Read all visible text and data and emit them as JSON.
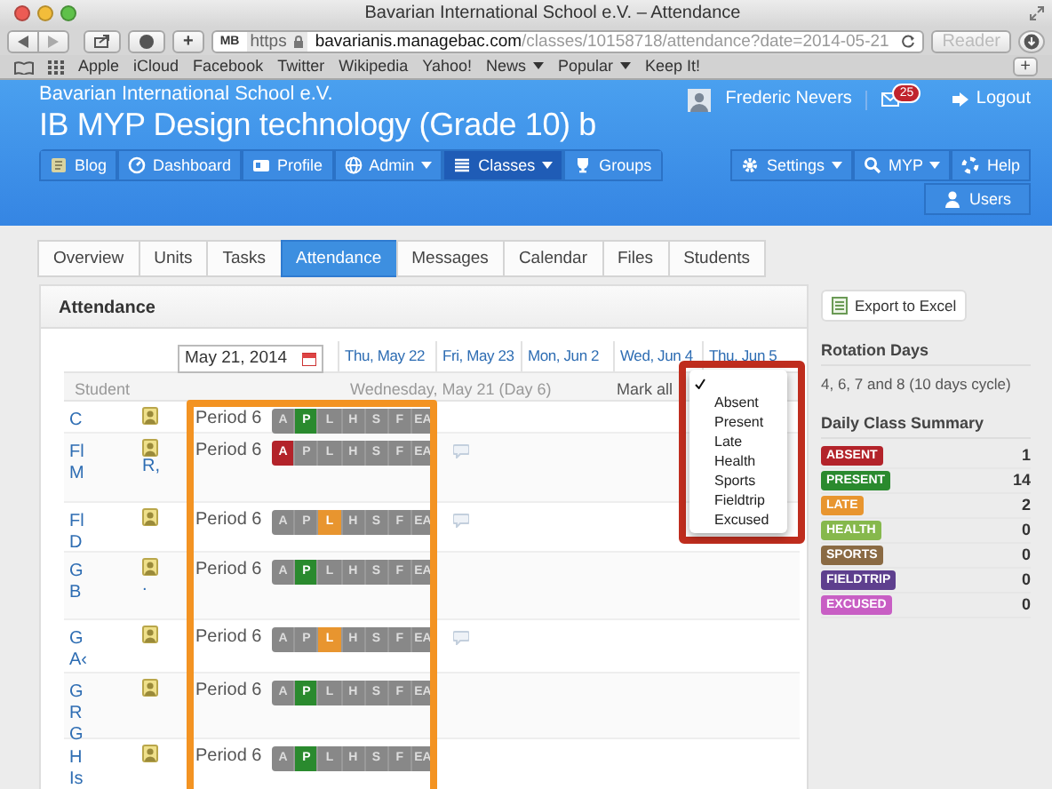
{
  "browser": {
    "title": "Bavarian International School e.V. – Attendance",
    "new_tab": "+",
    "favicon": "MB",
    "scheme": "https",
    "host": "bavarianis.managebac.com",
    "path": "/classes/10158718/attendance?date=2014-05-21",
    "reader": "Reader",
    "reader_disabled": true,
    "bookmarks": [
      {
        "label": "Apple",
        "menu": false
      },
      {
        "label": "iCloud",
        "menu": false
      },
      {
        "label": "Facebook",
        "menu": false
      },
      {
        "label": "Twitter",
        "menu": false
      },
      {
        "label": "Wikipedia",
        "menu": false
      },
      {
        "label": "Yahoo!",
        "menu": false
      },
      {
        "label": "News",
        "menu": true
      },
      {
        "label": "Popular",
        "menu": true
      },
      {
        "label": "Keep It!",
        "menu": false
      }
    ],
    "add_bookmark": "+"
  },
  "header": {
    "school": "Bavarian International School e.V.",
    "class_title": "IB MYP Design technology (Grade 10) b",
    "user": "Frederic Nevers",
    "mail_count": "25",
    "logout": "Logout",
    "nav": [
      {
        "label": "Blog",
        "dropdown": false,
        "selected": false
      },
      {
        "label": "Dashboard",
        "dropdown": false,
        "selected": false
      },
      {
        "label": "Profile",
        "dropdown": false,
        "selected": false
      },
      {
        "label": "Admin",
        "dropdown": true,
        "selected": false
      },
      {
        "label": "Classes",
        "dropdown": true,
        "selected": true
      },
      {
        "label": "Groups",
        "dropdown": false,
        "selected": false
      }
    ],
    "nav_right": [
      {
        "label": "Settings",
        "dropdown": true
      },
      {
        "label": "MYP",
        "dropdown": true
      },
      {
        "label": "Help",
        "dropdown": false
      }
    ],
    "nav_users": "Users"
  },
  "tabs": [
    {
      "label": "Overview",
      "selected": false
    },
    {
      "label": "Units",
      "selected": false
    },
    {
      "label": "Tasks",
      "selected": false
    },
    {
      "label": "Attendance",
      "selected": true
    },
    {
      "label": "Messages",
      "selected": false
    },
    {
      "label": "Calendar",
      "selected": false
    },
    {
      "label": "Files",
      "selected": false
    },
    {
      "label": "Students",
      "selected": false
    }
  ],
  "attendance": {
    "title": "Attendance",
    "date": "May 21, 2014",
    "day_columns": [
      "Thu, May 22",
      "Fri, May 23",
      "Mon, Jun 2",
      "Wed, Jun 4",
      "Thu, Jun 5"
    ],
    "student_header": "Student",
    "day_label": "Wednesday, May 21 (Day 6)",
    "mark_all": "Mark all",
    "rows": [
      {
        "name": [
          "C"
        ],
        "note": [],
        "period": "Period 6",
        "comment": false,
        "marks": [
          {
            "code": "A",
            "selected": false
          },
          {
            "code": "P",
            "selected": true
          },
          {
            "code": "L",
            "selected": false
          },
          {
            "code": "H",
            "selected": false
          },
          {
            "code": "S",
            "selected": false
          },
          {
            "code": "F",
            "selected": false
          },
          {
            "code": "EA",
            "selected": false
          }
        ]
      },
      {
        "name": [
          "Fl",
          "M"
        ],
        "note": [
          "R,"
        ],
        "period": "Period 6",
        "comment": true,
        "marks": [
          {
            "code": "A",
            "selected": true
          },
          {
            "code": "P",
            "selected": false
          },
          {
            "code": "L",
            "selected": false
          },
          {
            "code": "H",
            "selected": false
          },
          {
            "code": "S",
            "selected": false
          },
          {
            "code": "F",
            "selected": false
          },
          {
            "code": "EA",
            "selected": false
          }
        ]
      },
      {
        "name": [
          "Fl",
          "D"
        ],
        "note": [],
        "period": "Period 6",
        "comment": true,
        "marks": [
          {
            "code": "A",
            "selected": false
          },
          {
            "code": "P",
            "selected": false
          },
          {
            "code": "L",
            "selected": true
          },
          {
            "code": "H",
            "selected": false
          },
          {
            "code": "S",
            "selected": false
          },
          {
            "code": "F",
            "selected": false
          },
          {
            "code": "EA",
            "selected": false
          }
        ]
      },
      {
        "name": [
          "G",
          "B"
        ],
        "note": [
          "."
        ],
        "period": "Period 6",
        "comment": false,
        "marks": [
          {
            "code": "A",
            "selected": false
          },
          {
            "code": "P",
            "selected": true
          },
          {
            "code": "L",
            "selected": false
          },
          {
            "code": "H",
            "selected": false
          },
          {
            "code": "S",
            "selected": false
          },
          {
            "code": "F",
            "selected": false
          },
          {
            "code": "EA",
            "selected": false
          }
        ]
      },
      {
        "name": [
          "G",
          "A‹"
        ],
        "note": [],
        "period": "Period 6",
        "comment": true,
        "marks": [
          {
            "code": "A",
            "selected": false
          },
          {
            "code": "P",
            "selected": false
          },
          {
            "code": "L",
            "selected": true
          },
          {
            "code": "H",
            "selected": false
          },
          {
            "code": "S",
            "selected": false
          },
          {
            "code": "F",
            "selected": false
          },
          {
            "code": "EA",
            "selected": false
          }
        ]
      },
      {
        "name": [
          "G",
          "R",
          "G"
        ],
        "note": [],
        "period": "Period 6",
        "comment": false,
        "marks": [
          {
            "code": "A",
            "selected": false
          },
          {
            "code": "P",
            "selected": true
          },
          {
            "code": "L",
            "selected": false
          },
          {
            "code": "H",
            "selected": false
          },
          {
            "code": "S",
            "selected": false
          },
          {
            "code": "F",
            "selected": false
          },
          {
            "code": "EA",
            "selected": false
          }
        ]
      },
      {
        "name": [
          "H",
          "Is"
        ],
        "note": [],
        "period": "Period 6",
        "comment": false,
        "marks": [
          {
            "code": "A",
            "selected": false
          },
          {
            "code": "P",
            "selected": true
          },
          {
            "code": "L",
            "selected": false
          },
          {
            "code": "H",
            "selected": false
          },
          {
            "code": "S",
            "selected": false
          },
          {
            "code": "F",
            "selected": false
          },
          {
            "code": "EA",
            "selected": false
          }
        ]
      }
    ],
    "mark_menu": [
      {
        "selected": true
      },
      {
        "label": "Absent",
        "selected": false
      },
      {
        "label": "Present",
        "selected": false
      },
      {
        "label": "Late",
        "selected": false
      },
      {
        "label": "Health",
        "selected": false
      },
      {
        "label": "Sports",
        "selected": false
      },
      {
        "label": "Fieldtrip",
        "selected": false
      },
      {
        "label": "Excused",
        "selected": false
      }
    ]
  },
  "sidebar": {
    "export": "Export to Excel",
    "rotation_title": "Rotation Days",
    "rotation_text": "4, 6, 7 and 8 (10 days cycle)",
    "summary_title": "Daily Class Summary",
    "summary": [
      {
        "label": "ABSENT",
        "count": "1",
        "color": "#b3232a"
      },
      {
        "label": "PRESENT",
        "count": "14",
        "color": "#2a8a2e"
      },
      {
        "label": "LATE",
        "count": "2",
        "color": "#e8952f"
      },
      {
        "label": "HEALTH",
        "count": "0",
        "color": "#86b84c"
      },
      {
        "label": "SPORTS",
        "count": "0",
        "color": "#8a6a43"
      },
      {
        "label": "FIELDTRIP",
        "count": "0",
        "color": "#5e3f8e"
      },
      {
        "label": "EXCUSED",
        "count": "0",
        "color": "#c85ec4"
      }
    ]
  }
}
